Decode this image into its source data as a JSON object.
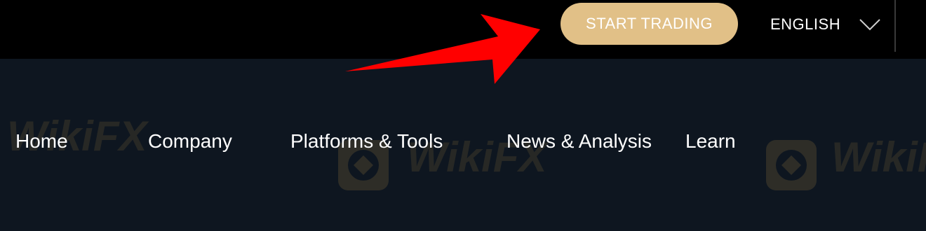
{
  "topbar": {
    "start_trading_label": "START TRADING",
    "language_label": "ENGLISH"
  },
  "nav": {
    "items": [
      {
        "label": "Home"
      },
      {
        "label": "Company"
      },
      {
        "label": "Platforms & Tools"
      },
      {
        "label": "News & Analysis"
      },
      {
        "label": "Learn"
      }
    ]
  },
  "watermark": {
    "text": "WikiFX"
  },
  "icons": {
    "chevron": "chevron-down-icon",
    "arrow": "red-arrow-annotation-icon",
    "watermark_logo": "wikifx-logo-icon"
  },
  "colors": {
    "topbar_bg": "#000000",
    "page_bg": "#0e1620",
    "accent": "#e1c087",
    "arrow": "#ff0000",
    "text": "#ffffff"
  }
}
